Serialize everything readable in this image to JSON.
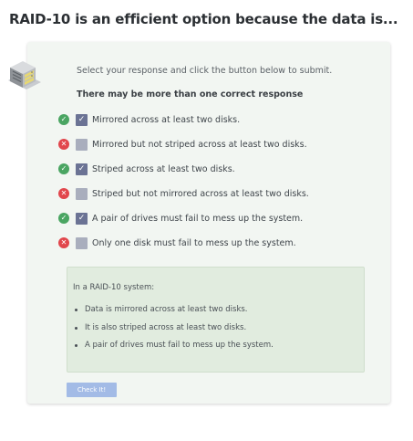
{
  "question": {
    "title": "RAID-10 is an efficient option because the data is..."
  },
  "prompt": {
    "instructions": "Select your response and click the button below to submit.",
    "note": "There may be more than one correct response"
  },
  "options": [
    {
      "label": "Mirrored across at least two disks.",
      "result": "correct",
      "result_icon": "check-icon",
      "checked": true
    },
    {
      "label": "Mirrored but not striped across at least two disks.",
      "result": "incorrect",
      "result_icon": "x-icon",
      "checked": false
    },
    {
      "label": "Striped across at least two disks.",
      "result": "correct",
      "result_icon": "check-icon",
      "checked": true
    },
    {
      "label": "Striped but not mirrored across at least two disks.",
      "result": "incorrect",
      "result_icon": "x-icon",
      "checked": false
    },
    {
      "label": "A pair of drives must fail to mess up the system.",
      "result": "correct",
      "result_icon": "check-icon",
      "checked": true
    },
    {
      "label": "Only one disk must fail to mess up the system.",
      "result": "incorrect",
      "result_icon": "x-icon",
      "checked": false
    }
  ],
  "feedback": {
    "intro": "In a RAID-10 system:",
    "items": [
      "Data is mirrored across at least two disks.",
      "It is also striped across at least two disks.",
      "A pair of drives must fail to mess up the system."
    ]
  },
  "submit": {
    "label": "Check It!",
    "enabled": false
  },
  "colors": {
    "correct": "#4aa562",
    "incorrect": "#e1464c",
    "checkbox_checked": "#6b7394",
    "checkbox_unchecked": "#a9aebd",
    "feedback_bg": "#e1ecdf",
    "button": "#a3bbe6"
  }
}
